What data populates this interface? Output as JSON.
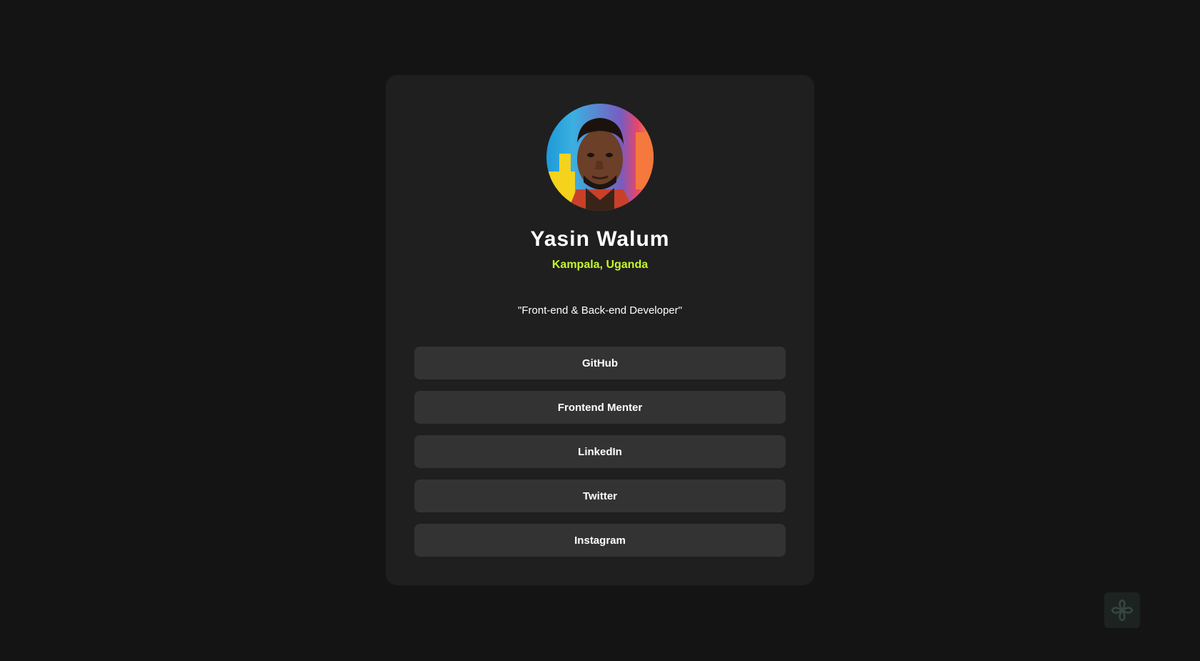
{
  "profile": {
    "name": "Yasin Walum",
    "location": "Kampala, Uganda",
    "bio": "\"Front-end & Back-end Developer\"",
    "avatar_icon": "profile-photo"
  },
  "links": [
    {
      "label": "GitHub"
    },
    {
      "label": "Frontend Menter"
    },
    {
      "label": "LinkedIn"
    },
    {
      "label": "Twitter"
    },
    {
      "label": "Instagram"
    }
  ],
  "colors": {
    "background": "#141414",
    "card": "#1f1f1f",
    "button": "#333333",
    "accent": "#c4f82a",
    "text": "#ffffff"
  },
  "widget": {
    "icon": "flower-logo-icon"
  }
}
